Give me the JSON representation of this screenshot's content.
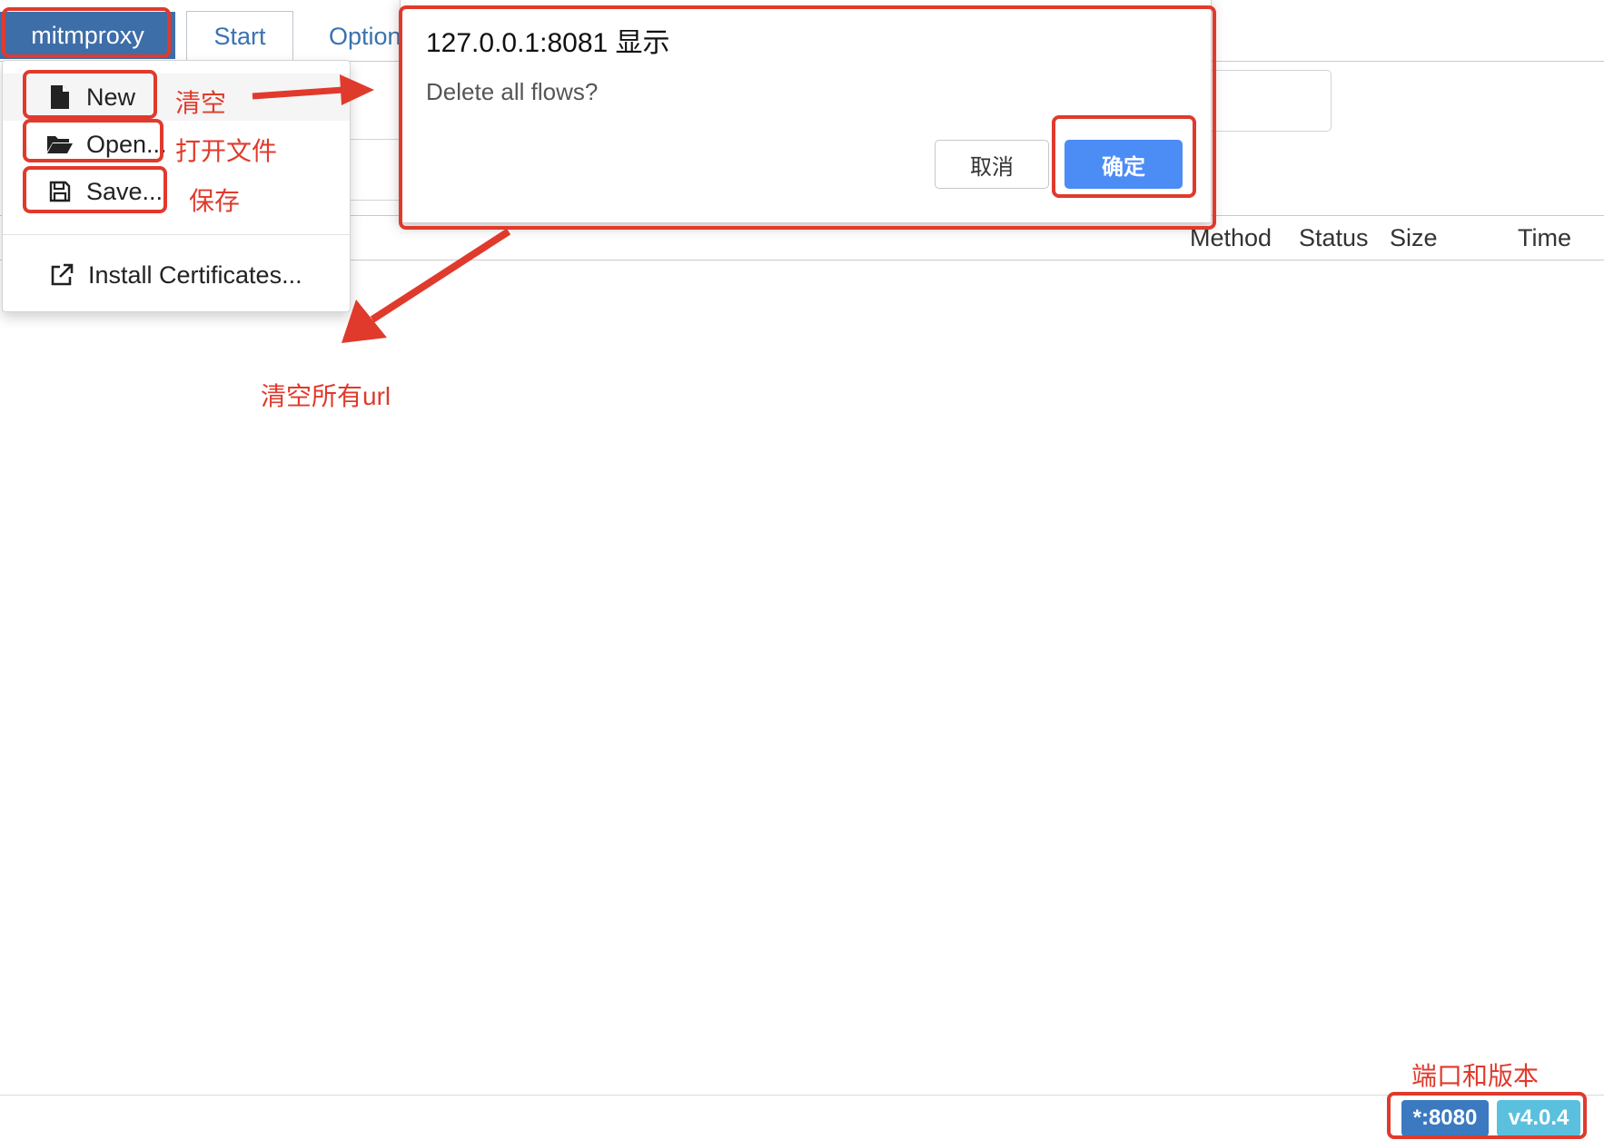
{
  "nav": {
    "brand": "mitmproxy",
    "tabs": [
      "Start",
      "Options"
    ]
  },
  "table": {
    "columns": [
      "Method",
      "Status",
      "Size",
      "Time"
    ]
  },
  "menu": {
    "items": [
      {
        "label": "New",
        "icon": "file-icon"
      },
      {
        "label": "Open...",
        "icon": "folder-open-icon"
      },
      {
        "label": "Save...",
        "icon": "floppy-disk-icon"
      },
      {
        "label": "Install Certificates...",
        "icon": "external-link-icon"
      }
    ]
  },
  "dialog": {
    "title": "127.0.0.1:8081 显示",
    "message": "Delete all flows?",
    "cancel_label": "取消",
    "ok_label": "确定"
  },
  "footer": {
    "port": "*:8080",
    "version": "v4.0.4"
  },
  "annotations": {
    "new_note": "清空",
    "open_note": "打开文件",
    "save_note": "保存",
    "dialog_note": "清空所有url",
    "footer_note": "端口和版本"
  },
  "colors": {
    "brand_bg": "#3e6ea8",
    "link": "#3a72b0",
    "ok_button": "#4c8cf5",
    "port_badge": "#3b7ac0",
    "version_badge": "#5bc0de",
    "annotation_red": "#e03a2c"
  }
}
